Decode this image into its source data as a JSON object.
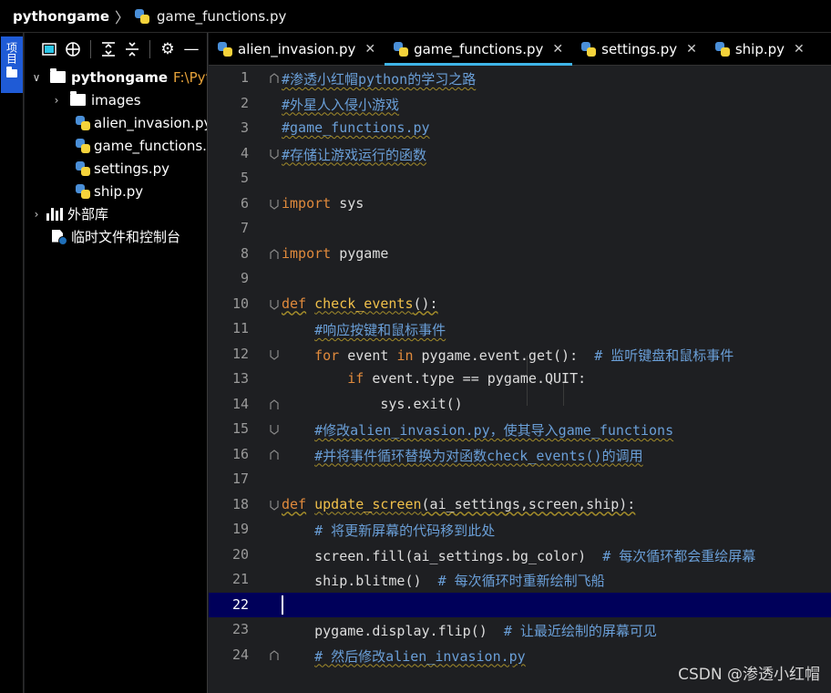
{
  "breadcrumb": {
    "project": "pythongame",
    "file": "game_functions.py"
  },
  "left_strip": {
    "project_tab_label": "项目"
  },
  "project_tree": {
    "root": {
      "name": "pythongame",
      "path": "F:\\Pyt"
    },
    "items": [
      {
        "name": "images",
        "type": "folder"
      },
      {
        "name": "alien_invasion.py",
        "type": "python-file"
      },
      {
        "name": "game_functions.py",
        "type": "python-file"
      },
      {
        "name": "settings.py",
        "type": "python-file"
      },
      {
        "name": "ship.py",
        "type": "python-file"
      }
    ],
    "external_libs": "外部库",
    "scratches": "临时文件和控制台"
  },
  "tabs": [
    {
      "label": "alien_invasion.py",
      "active": false
    },
    {
      "label": "game_functions.py",
      "active": true
    },
    {
      "label": "settings.py",
      "active": false
    },
    {
      "label": "ship.py",
      "active": false
    }
  ],
  "editor": {
    "current_line": 22,
    "line_numbers": [
      "1",
      "2",
      "3",
      "4",
      "5",
      "6",
      "7",
      "8",
      "9",
      "10",
      "11",
      "12",
      "13",
      "14",
      "15",
      "16",
      "17",
      "18",
      "19",
      "20",
      "21",
      "22",
      "23",
      "24"
    ],
    "code": {
      "l1": "#渗透小红帽python的学习之路",
      "l2": "#外星人入侵小游戏",
      "l3": "#game_functions.py",
      "l4": "#存储让游戏运行的函数",
      "l6_kw": "import",
      "l6_rest": " sys",
      "l8_kw": "import",
      "l8_rest": " pygame",
      "l10_kw": "def",
      "l10_fn": "check_events",
      "l10_rest": "():",
      "l11": "#响应按键和鼠标事件",
      "l12_kw1": "for",
      "l12_a": " event ",
      "l12_kw2": "in",
      "l12_b": " pygame.event.get():  ",
      "l12_cm": "# 监听键盘和鼠标事件",
      "l13_kw": "if",
      "l13_rest": " event.type == pygame.QUIT:",
      "l14": "sys.exit()",
      "l15": "#修改alien_invasion.py，使其导入game_functions",
      "l16": "#并将事件循环替换为对函数check_events()的调用",
      "l18_kw": "def",
      "l18_fn": "update_screen",
      "l18_rest": "(ai_settings,screen,ship):",
      "l19": "# 将更新屏幕的代码移到此处",
      "l20_code": "screen.fill(ai_settings.bg_color)  ",
      "l20_cm": "# 每次循环都会重绘屏幕",
      "l21_code": "ship.blitme()  ",
      "l21_cm": "# 每次循环时重新绘制飞船",
      "l23_code": "pygame.display.flip()  ",
      "l23_cm": "# 让最近绘制的屏幕可见",
      "l24": "# 然后修改alien_invasion.py"
    }
  },
  "watermark": "CSDN @渗透小红帽"
}
